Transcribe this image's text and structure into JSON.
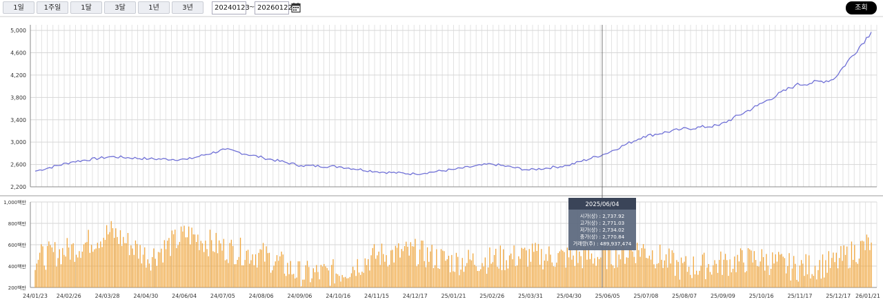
{
  "toolbar": {
    "periods": [
      "1일",
      "1주일",
      "1달",
      "3달",
      "1년",
      "3년"
    ],
    "start_date": "20240123",
    "separator": "~",
    "end_date": "20260122",
    "calendar_icon": "calendar-icon",
    "query_label": "조회"
  },
  "tooltip": {
    "date": "2025/06/04",
    "rows": [
      "시가(상) : 2,737.92",
      "고가(상) : 2,771.03",
      "저가(상) : 2,734.02",
      "종가(상) : 2,770.84",
      "거래량(주) : 489,937,474"
    ]
  },
  "chart_data": [
    {
      "type": "line",
      "x_start": "24/01/23",
      "x_end": "26/01/21",
      "ylim": [
        2200,
        5100
      ],
      "yticks": [
        "2,200",
        "2,600",
        "3,000",
        "3,400",
        "3,800",
        "4,200",
        "4,600",
        "5,000"
      ],
      "xticks": [
        "24/01/23",
        "24/02/26",
        "24/03/28",
        "24/04/30",
        "24/06/04",
        "24/07/05",
        "24/08/06",
        "24/09/06",
        "24/10/16",
        "24/11/15",
        "24/12/17",
        "25/01/21",
        "25/02/26",
        "25/03/31",
        "25/04/30",
        "25/06/05",
        "25/07/08",
        "25/08/07",
        "25/09/09",
        "25/10/16",
        "25/11/17",
        "25/12/17",
        "26/01/21"
      ],
      "x": [
        "24/01/23",
        "24/02/26",
        "24/03/28",
        "24/04/30",
        "24/06/04",
        "24/07/05",
        "24/08/06",
        "24/09/06",
        "24/10/16",
        "24/11/15",
        "24/12/17",
        "25/01/21",
        "25/02/26",
        "25/03/31",
        "25/04/30",
        "25/06/05",
        "25/07/08",
        "25/08/07",
        "25/09/09",
        "25/10/16",
        "25/11/17",
        "25/12/17",
        "26/01/21"
      ],
      "values": [
        2480,
        2650,
        2740,
        2700,
        2690,
        2870,
        2720,
        2580,
        2560,
        2470,
        2430,
        2510,
        2610,
        2500,
        2580,
        2790,
        3100,
        3230,
        3300,
        3650,
        4020,
        4120,
        4970
      ],
      "color": "#6e6fd6"
    },
    {
      "type": "bar",
      "yticks": [
        "200백만",
        "400백만",
        "600백만",
        "800백만",
        "1,000백만"
      ],
      "ylim": [
        200,
        1000
      ],
      "x": [
        "24/01/23",
        "24/02/26",
        "24/03/28",
        "24/04/30",
        "24/06/04",
        "24/07/05",
        "24/08/06",
        "24/09/06",
        "24/10/16",
        "24/11/15",
        "24/12/17",
        "25/01/21",
        "25/02/26",
        "25/03/31",
        "25/04/30",
        "25/06/05",
        "25/07/08",
        "25/08/07",
        "25/09/09",
        "25/10/16",
        "25/11/17",
        "25/12/17",
        "26/01/21"
      ],
      "values": [
        470,
        560,
        720,
        480,
        700,
        560,
        500,
        320,
        340,
        500,
        530,
        440,
        460,
        500,
        480,
        490,
        560,
        380,
        420,
        470,
        380,
        420,
        620
      ],
      "color": "#f0a53a"
    }
  ]
}
